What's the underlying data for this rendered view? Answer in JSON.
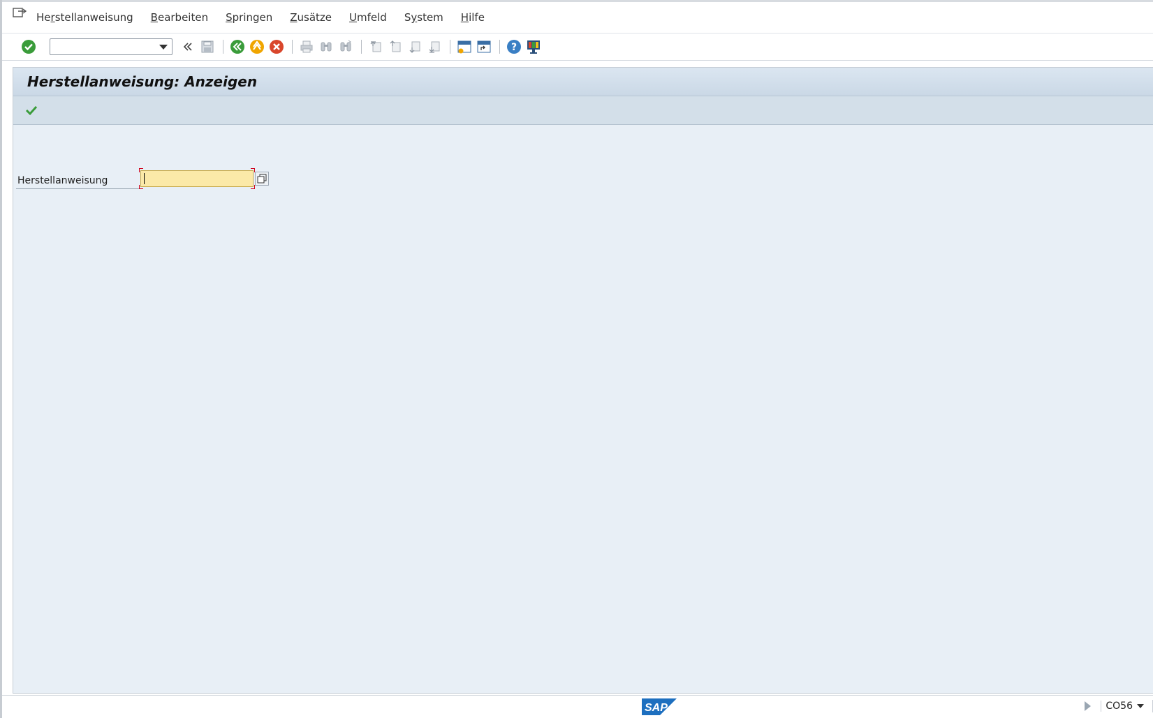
{
  "menu": {
    "items": [
      {
        "pre": "He",
        "ul": "r",
        "post": "stellanweisung"
      },
      {
        "pre": "",
        "ul": "B",
        "post": "earbeiten"
      },
      {
        "pre": "",
        "ul": "S",
        "post": "pringen"
      },
      {
        "pre": "",
        "ul": "Z",
        "post": "usätze"
      },
      {
        "pre": "",
        "ul": "U",
        "post": "mfeld"
      },
      {
        "pre": "S",
        "ul": "y",
        "post": "stem"
      },
      {
        "pre": "",
        "ul": "H",
        "post": "ilfe"
      }
    ]
  },
  "toolbar": {
    "command_value": "",
    "icons": [
      "enter-icon",
      "back-double-arrow-icon",
      "save-icon",
      "back-icon",
      "exit-icon",
      "cancel-icon",
      "print-icon",
      "find-icon",
      "find-next-icon",
      "first-page-icon",
      "previous-page-icon",
      "next-page-icon",
      "last-page-icon",
      "new-session-icon",
      "shortcut-icon",
      "help-icon",
      "customize-layout-icon"
    ]
  },
  "screen": {
    "title": "Herstellanweisung: Anzeigen"
  },
  "form": {
    "label": "Herstellanweisung",
    "value": ""
  },
  "status": {
    "logo_text": "SAP",
    "transaction_code": "CO56"
  },
  "colors": {
    "content_bg": "#e8eff6",
    "required_field_bg": "#fbe9a8",
    "check_green": "#3a9c3a",
    "sap_blue": "#1d6fbf"
  }
}
